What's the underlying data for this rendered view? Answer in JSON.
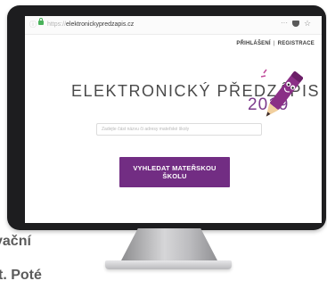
{
  "browser": {
    "url_protocol": "https://",
    "url_domain": "elektronickypredzapis.cz",
    "menu_glyph": "···",
    "star_glyph": "☆"
  },
  "nav": {
    "login": "PŘIHLÁŠENÍ",
    "separator": "|",
    "register": "REGISTRACE"
  },
  "logo": {
    "text": "ELEKTRONICKÝ PŘEDZÁPIS",
    "year": "2019"
  },
  "search": {
    "placeholder": "Zadejte část názvu či adresy mateřské školy"
  },
  "cta": {
    "label": "VYHLEDAT MATEŘSKOU ŠKOLU"
  },
  "background_text": {
    "line1": "vační",
    "line2": "t. Poté"
  },
  "colors": {
    "brand_purple": "#722d83",
    "monitor_frame": "#1d1d1f"
  }
}
